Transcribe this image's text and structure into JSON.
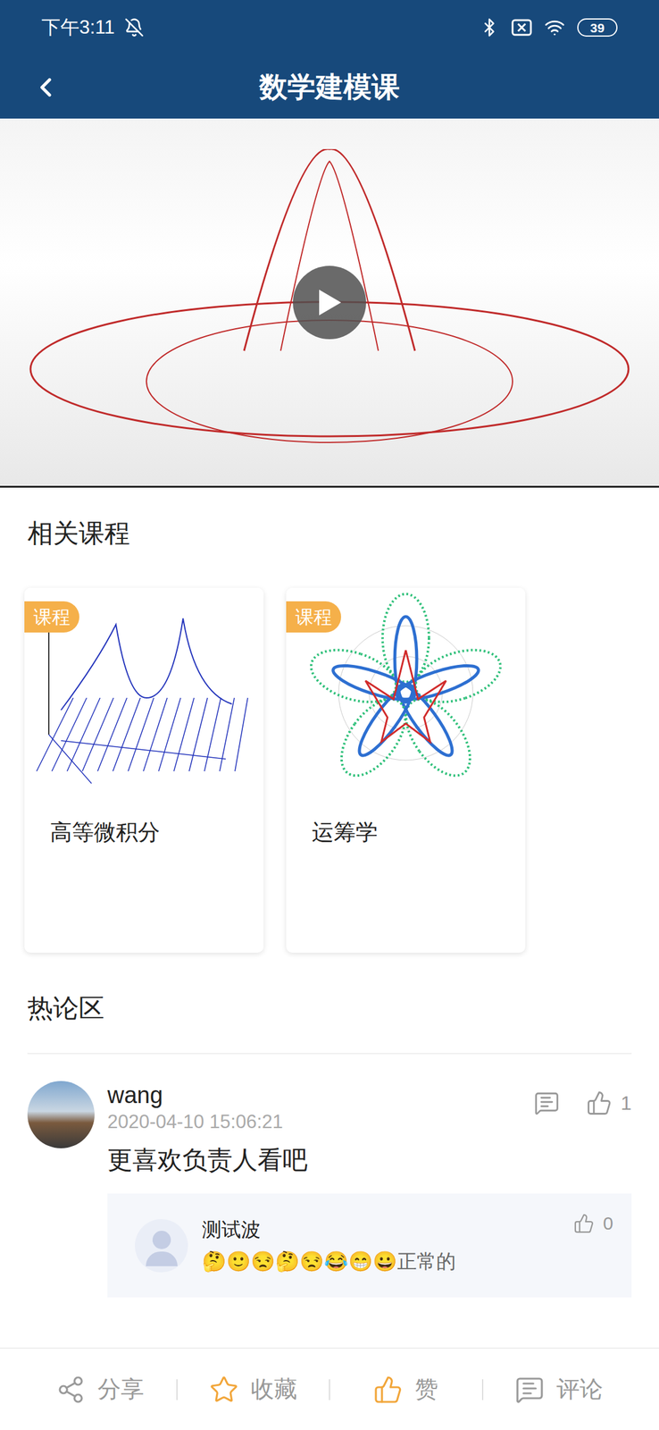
{
  "status_bar": {
    "time": "下午3:11",
    "battery": "39"
  },
  "header": {
    "title": "数学建模课"
  },
  "video": {
    "playing": false
  },
  "related": {
    "title": "相关课程",
    "courses": [
      {
        "badge": "课程",
        "title": "高等微积分"
      },
      {
        "badge": "课程",
        "title": "运筹学"
      }
    ]
  },
  "discussion": {
    "title": "热论区",
    "comments": [
      {
        "user": "wang",
        "time": "2020-04-10 15:06:21",
        "text": "更喜欢负责人看吧",
        "likes": "1",
        "replies": [
          {
            "user": "测试波",
            "text": "🤔🙂😒🤔😒😂😁😀正常的",
            "likes": "0"
          }
        ]
      }
    ]
  },
  "actions": [
    {
      "label": "分享",
      "color": "#9a9a9a"
    },
    {
      "label": "收藏",
      "color": "#f2a63a"
    },
    {
      "label": "赞",
      "color": "#f2a63a"
    },
    {
      "label": "评论",
      "color": "#9a9a9a"
    }
  ]
}
